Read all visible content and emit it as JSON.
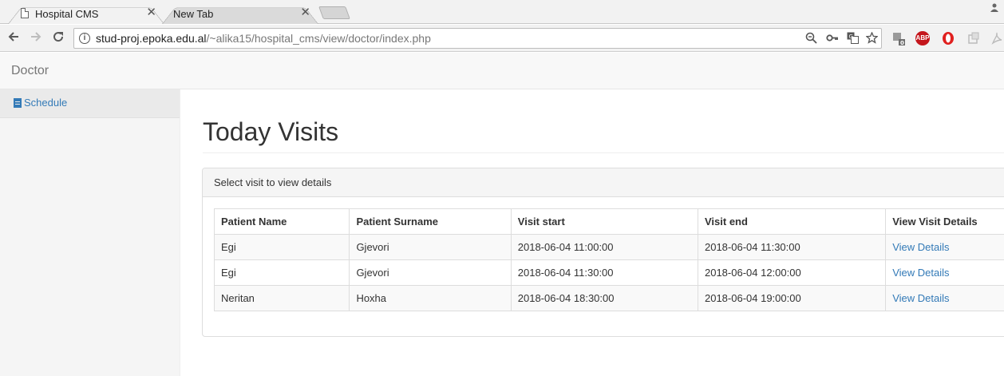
{
  "browser": {
    "tabs": [
      {
        "title": "Hospital CMS",
        "close": "✕"
      },
      {
        "title": "New Tab",
        "close": "✕"
      }
    ],
    "url_host": "stud-proj.epoka.edu.al",
    "url_path": "/~alika15/hospital_cms/view/doctor/index.php",
    "extensions": [
      {
        "name": "puzzle-extension-icon",
        "badge": "0"
      },
      {
        "name": "adblock-icon",
        "text": "ABP",
        "color": "#c4161c"
      },
      {
        "name": "opera-icon",
        "color": "#e0201f"
      }
    ]
  },
  "navbar": {
    "brand": "Doctor"
  },
  "sidebar": {
    "items": [
      {
        "label": "Schedule",
        "icon": "file-icon"
      }
    ]
  },
  "main": {
    "title": "Today Visits",
    "panel_heading": "Select visit to view details",
    "table": {
      "headers": [
        "Patient Name",
        "Patient Surname",
        "Visit start",
        "Visit end",
        "View Visit Details"
      ],
      "rows": [
        [
          "Egi",
          "Gjevori",
          "2018-06-04 11:00:00",
          "2018-06-04 11:30:00",
          "View Details"
        ],
        [
          "Egi",
          "Gjevori",
          "2018-06-04 11:30:00",
          "2018-06-04 12:00:00",
          "View Details"
        ],
        [
          "Neritan",
          "Hoxha",
          "2018-06-04 18:30:00",
          "2018-06-04 19:00:00",
          "View Details"
        ]
      ]
    }
  },
  "colors": {
    "link": "#337ab7",
    "brand_text": "#777777"
  }
}
